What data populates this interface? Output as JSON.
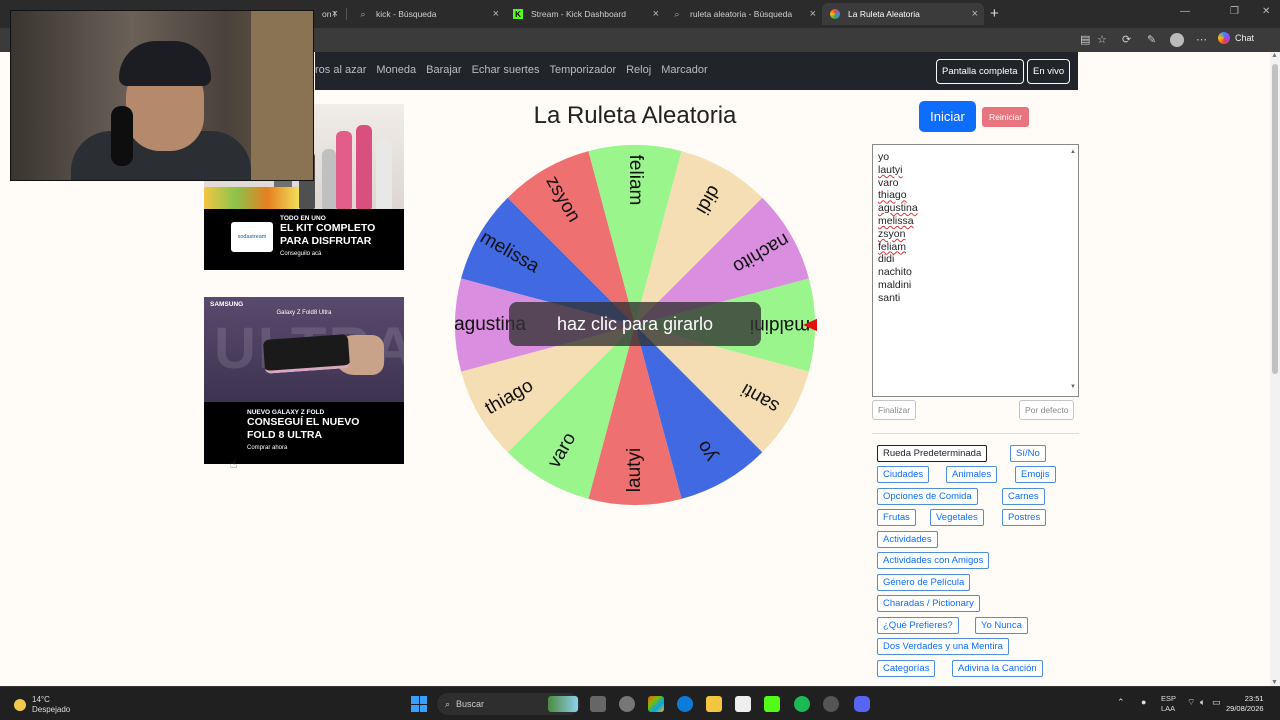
{
  "browser": {
    "tabs": [
      {
        "label": "on l",
        "active": false
      },
      {
        "label": "kick - Búsqueda",
        "active": false
      },
      {
        "label": "Stream - Kick Dashboard",
        "active": false
      },
      {
        "label": "ruleta aleatoria - Búsqueda",
        "active": false
      },
      {
        "label": "La Ruleta Aleatoria",
        "active": true
      }
    ],
    "new_tab": "+",
    "chat_label": "Chat"
  },
  "nav": {
    "links": [
      "ros al azar",
      "Moneda",
      "Barajar",
      "Echar suertes",
      "Temporizador",
      "Reloj",
      "Marcador"
    ],
    "fullscreen_label": "Pantalla completa",
    "live_label": "En vivo"
  },
  "ads": {
    "ad1": {
      "tagline": "TODO EN UNO",
      "headline": "EL KIT COMPLETO PARA DISFRUTAR",
      "cta": "Conseguilo acá",
      "brand": "sodastream"
    },
    "ad2": {
      "brand": "SAMSUNG",
      "product_top": "Galaxy Z Fold8 Ultra",
      "tagline": "NUEVO GALAXY Z FOLD",
      "headline": "CONSEGUÍ EL NUEVO FOLD 8 ULTRA",
      "cta": "Comprar ahora",
      "bg_word": "ULTRA"
    }
  },
  "title": "La Ruleta Aleatoria",
  "wheel": {
    "overlay_text": "haz clic para girarlo",
    "segments": [
      {
        "label": "maldini",
        "color": "#99f58c"
      },
      {
        "label": "santi",
        "color": "#f5deb3"
      },
      {
        "label": "yo",
        "color": "#4169e1"
      },
      {
        "label": "lautyi",
        "color": "#ef7070"
      },
      {
        "label": "varo",
        "color": "#99f58c"
      },
      {
        "label": "thiago",
        "color": "#f5deb3"
      },
      {
        "label": "agustina",
        "color": "#da8ee0"
      },
      {
        "label": "melissa",
        "color": "#4169e1"
      },
      {
        "label": "zsyon",
        "color": "#ef7070"
      },
      {
        "label": "feliam",
        "color": "#99f58c"
      },
      {
        "label": "didi",
        "color": "#f5deb3"
      },
      {
        "label": "nachito",
        "color": "#da8ee0"
      }
    ],
    "pointer_color": "#e01010"
  },
  "controls": {
    "start_label": "Iniciar",
    "reset_label": "Reiniciar",
    "names": [
      "yo",
      "lautyi",
      "varo",
      "thiago",
      "agustina",
      "melissa",
      "zsyon",
      "feliam",
      "didi",
      "nachito",
      "maldini",
      "santi"
    ],
    "finish_label": "Finalizar",
    "default_label": "Por defecto"
  },
  "presets": [
    "Rueda Predeterminada",
    "Sí/No",
    "Ciudades",
    "Animales",
    "Emojis",
    "Opciones de Comida",
    "Carnes",
    "Frutas",
    "Vegetales",
    "Postres",
    "Actividades",
    "Actividades con Amigos",
    "Género de Película",
    "Charadas / Pictionary",
    "¿Qué Prefieres?",
    "Yo Nunca",
    "Dos Verdades y una Mentira",
    "Categorías",
    "Adivina la Canción"
  ],
  "taskbar": {
    "temperature": "14°C",
    "weather": "Despejado",
    "search_label": "Buscar",
    "lang_top": "ESP",
    "lang_bottom": "LAA",
    "time": "23:51",
    "date": "29/08/2026"
  }
}
